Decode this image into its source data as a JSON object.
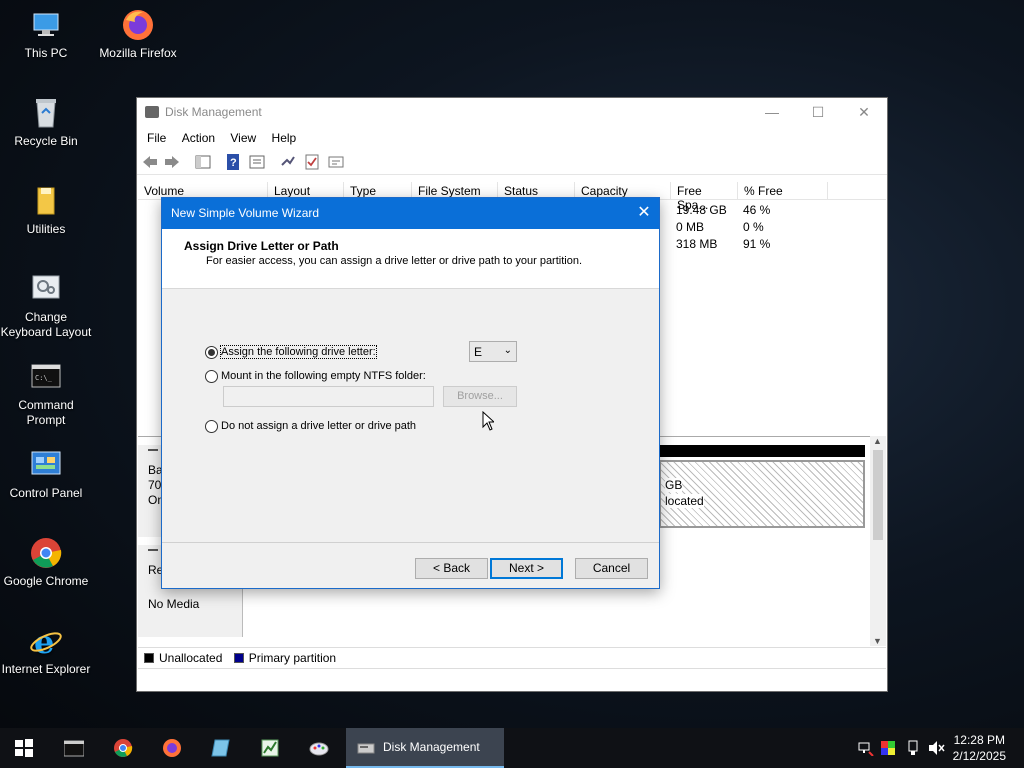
{
  "desktop": {
    "icons": [
      {
        "label": "This PC"
      },
      {
        "label": "Mozilla Firefox"
      },
      {
        "label": "Recycle Bin"
      },
      {
        "label": "Utilities"
      },
      {
        "label": "Change Keyboard Layout"
      },
      {
        "label": "Command Prompt"
      },
      {
        "label": "Control Panel"
      },
      {
        "label": "Google Chrome"
      },
      {
        "label": "Internet Explorer"
      }
    ]
  },
  "disk_management": {
    "title": "Disk Management",
    "menu": [
      "File",
      "Action",
      "View",
      "Help"
    ],
    "columns": [
      "Volume",
      "Layout",
      "Type",
      "File System",
      "Status",
      "Capacity",
      "Free Spa...",
      "% Free"
    ],
    "rows": [
      {
        "free": "19.48 GB",
        "pct": "46 %"
      },
      {
        "free": "0 MB",
        "pct": "0 %"
      },
      {
        "free": "318 MB",
        "pct": "91 %"
      }
    ],
    "graph": {
      "disk0_label_lines": [
        "Ba",
        "70.",
        "On"
      ],
      "unallocated_size": "GB",
      "unallocated_text": "located",
      "cdrom_label": "Re",
      "cdrom_status": "No Media"
    },
    "legend": {
      "unallocated": "Unallocated",
      "primary": "Primary partition",
      "unallocated_color": "#000000",
      "primary_color": "#00008b"
    }
  },
  "wizard": {
    "title": "New Simple Volume Wizard",
    "heading": "Assign Drive Letter or Path",
    "subheading": "For easier access, you can assign a drive letter or drive path to your partition.",
    "option_assign": "Assign the following drive letter:",
    "option_mount": "Mount in the following empty NTFS folder:",
    "option_none": "Do not assign a drive letter or drive path",
    "drive_letter": "E",
    "folder_path": "",
    "browse_label": "Browse...",
    "back_label": "< Back",
    "next_label": "Next >",
    "cancel_label": "Cancel",
    "accent_color": "#0a6fd8"
  },
  "taskbar": {
    "active_app": "Disk Management",
    "time": "12:28 PM",
    "date": "2/12/2025"
  }
}
